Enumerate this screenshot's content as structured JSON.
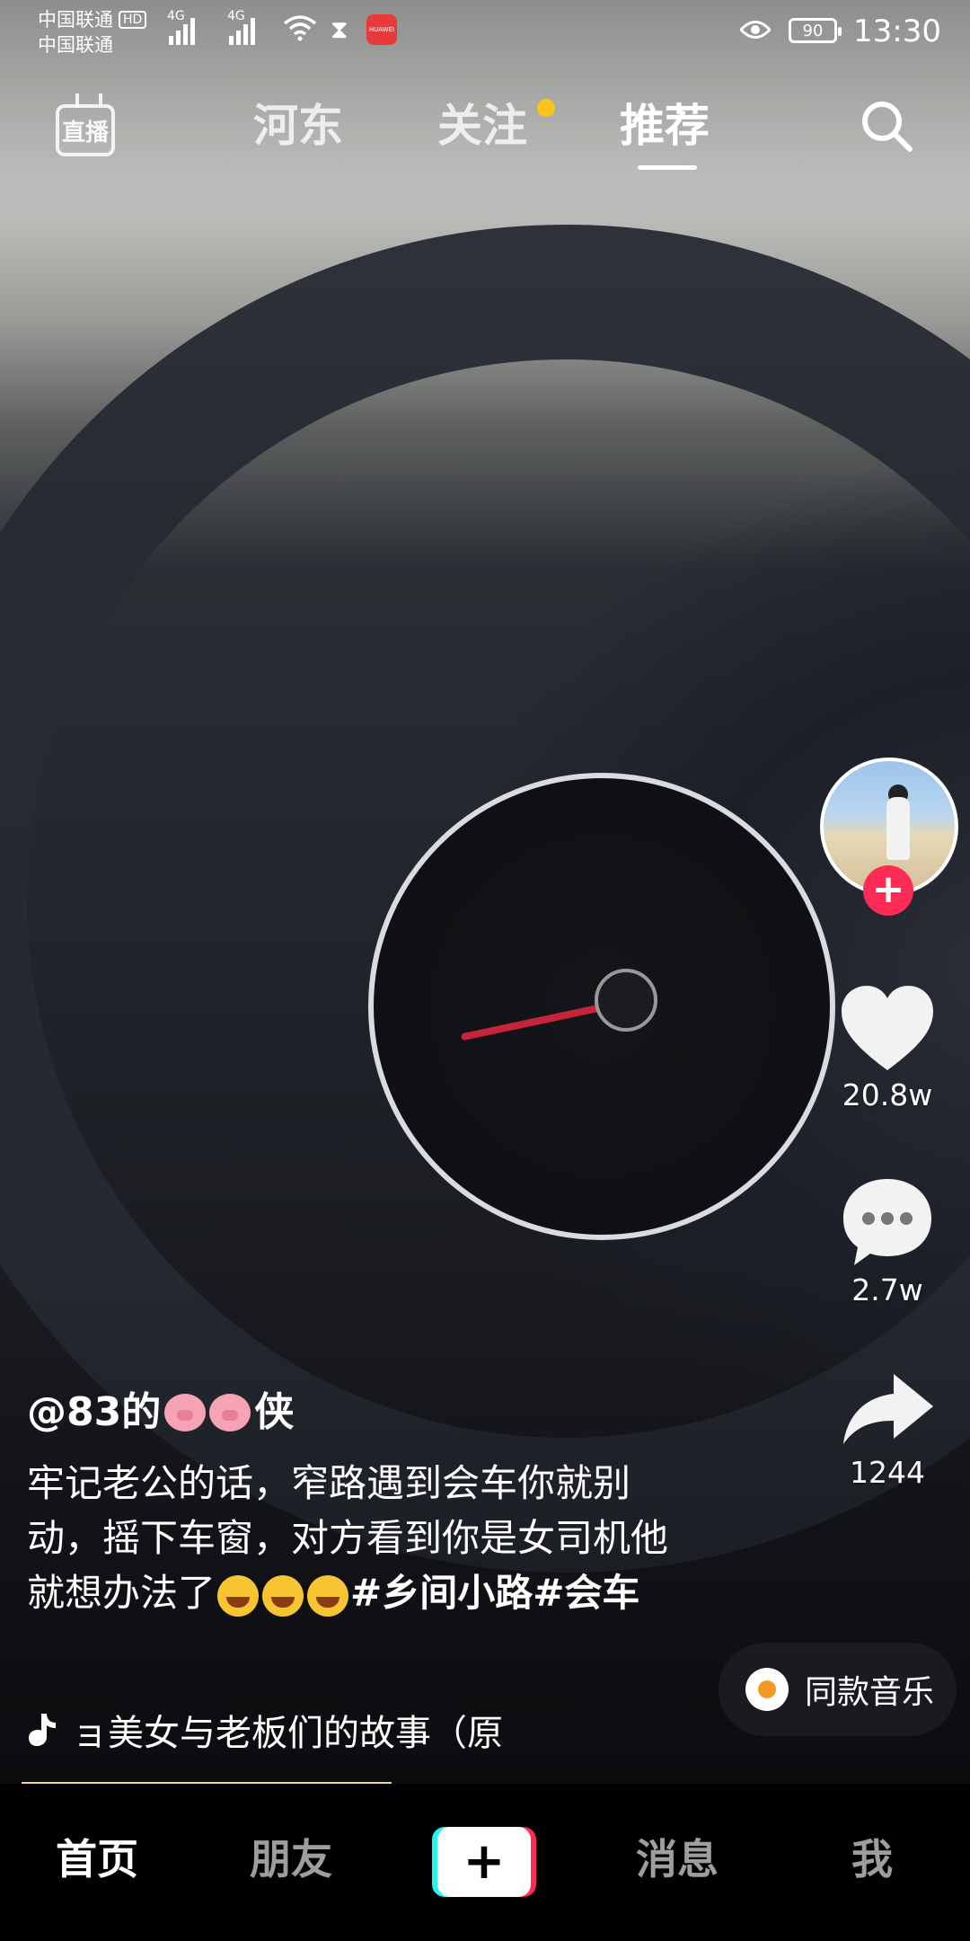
{
  "status_bar": {
    "carrier1": "中国联通",
    "carrier2": "中国联通",
    "hd_label": "HD",
    "network1": "4G",
    "network2": "4G",
    "app_badge": "HUAWEI",
    "battery": "90",
    "time": "13:30"
  },
  "top_nav": {
    "live_label": "直播",
    "tabs": [
      "河东",
      "关注",
      "推荐"
    ],
    "active_tab": "推荐",
    "follow_dot_color": "#f9c31c"
  },
  "video": {
    "author": "@83的",
    "author_suffix": "侠",
    "caption_text": "牢记老公的话，窄路遇到会车你就别动，摇下车窗，对方看到你是女司机他就想办法了",
    "hashtags": "#乡间小路#会车",
    "music_text": "ョ美女与老板们的故事（原",
    "same_music_label": "同款音乐"
  },
  "actions": {
    "likes": "20.8w",
    "comments": "2.7w",
    "shares": "1244",
    "follow_plus": "+"
  },
  "bottom_nav": {
    "home": "首页",
    "friends": "朋友",
    "create": "+",
    "messages": "消息",
    "me": "我"
  },
  "colors": {
    "accent_red": "#fe2c55",
    "accent_cyan": "#25f4ee"
  }
}
